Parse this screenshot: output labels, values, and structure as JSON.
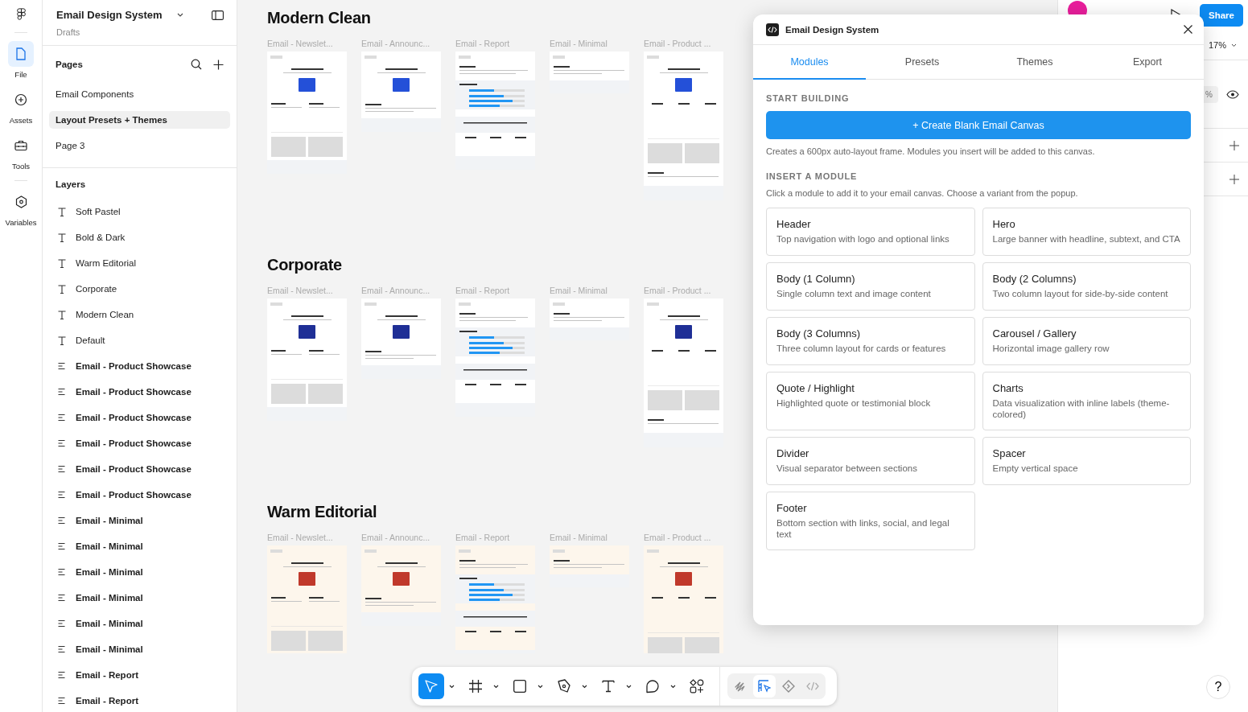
{
  "rail": {
    "items": [
      {
        "kind": "file",
        "label": "File",
        "selected": true
      },
      {
        "kind": "assets",
        "label": "Assets",
        "selected": false
      },
      {
        "kind": "tools",
        "label": "Tools",
        "selected": false
      },
      {
        "kind": "variables",
        "label": "Variables",
        "selected": false
      }
    ]
  },
  "sidebar": {
    "file_name": "Email Design System",
    "location": "Drafts",
    "pages_title": "Pages",
    "pages": [
      {
        "label": "Email Components",
        "selected": false
      },
      {
        "label": "Layout Presets + Themes",
        "selected": true
      },
      {
        "label": "Page 3",
        "selected": false
      }
    ],
    "layers_title": "Layers",
    "layers": [
      {
        "kind": "text",
        "label": "Soft Pastel"
      },
      {
        "kind": "text",
        "label": "Bold & Dark"
      },
      {
        "kind": "text",
        "label": "Warm Editorial"
      },
      {
        "kind": "text",
        "label": "Corporate"
      },
      {
        "kind": "text",
        "label": "Modern Clean"
      },
      {
        "kind": "text",
        "label": "Default"
      },
      {
        "kind": "frame",
        "label": "Email - Product Showcase"
      },
      {
        "kind": "frame",
        "label": "Email - Product Showcase"
      },
      {
        "kind": "frame",
        "label": "Email - Product Showcase"
      },
      {
        "kind": "frame",
        "label": "Email - Product Showcase"
      },
      {
        "kind": "frame",
        "label": "Email - Product Showcase"
      },
      {
        "kind": "frame",
        "label": "Email - Product Showcase"
      },
      {
        "kind": "frame",
        "label": "Email - Minimal"
      },
      {
        "kind": "frame",
        "label": "Email - Minimal"
      },
      {
        "kind": "frame",
        "label": "Email - Minimal"
      },
      {
        "kind": "frame",
        "label": "Email - Minimal"
      },
      {
        "kind": "frame",
        "label": "Email - Minimal"
      },
      {
        "kind": "frame",
        "label": "Email - Minimal"
      },
      {
        "kind": "frame",
        "label": "Email - Report"
      },
      {
        "kind": "frame",
        "label": "Email - Report"
      }
    ]
  },
  "canvas": {
    "sections": [
      {
        "title": "Modern Clean",
        "color": "#2450d8",
        "cream_paper": false,
        "frames": [
          {
            "kind": "newsletter",
            "label": "Email - Newslet..."
          },
          {
            "kind": "announcement",
            "label": "Email - Announc..."
          },
          {
            "kind": "report",
            "label": "Email - Report"
          },
          {
            "kind": "minimal",
            "label": "Email - Minimal"
          },
          {
            "kind": "product",
            "label": "Email - Product ..."
          }
        ]
      },
      {
        "title": "Corporate",
        "color": "#1f2f96",
        "cream_paper": false,
        "frames": [
          {
            "kind": "newsletter",
            "label": "Email - Newslet..."
          },
          {
            "kind": "announcement",
            "label": "Email - Announc..."
          },
          {
            "kind": "report",
            "label": "Email - Report"
          },
          {
            "kind": "minimal",
            "label": "Email - Minimal"
          },
          {
            "kind": "product",
            "label": "Email - Product ..."
          }
        ]
      },
      {
        "title": "Warm Editorial",
        "color": "#c0392b",
        "cream_paper": true,
        "frames": [
          {
            "kind": "newsletter",
            "label": "Email - Newslet..."
          },
          {
            "kind": "announcement",
            "label": "Email - Announc..."
          },
          {
            "kind": "report",
            "label": "Email - Report"
          },
          {
            "kind": "minimal",
            "label": "Email - Minimal"
          },
          {
            "kind": "product",
            "label": "Email - Product ..."
          }
        ]
      }
    ]
  },
  "right_panel": {
    "share": "Share",
    "zoom": "17%",
    "field_suffix": "%"
  },
  "plugin": {
    "title": "Email Design System",
    "tabs": [
      {
        "label": "Modules",
        "selected": true
      },
      {
        "label": "Presets",
        "selected": false
      },
      {
        "label": "Themes",
        "selected": false
      },
      {
        "label": "Export",
        "selected": false
      }
    ],
    "start_heading": "START BUILDING",
    "create_button": "+ Create Blank Email Canvas",
    "create_note": "Creates a 600px auto-layout frame. Modules you insert will be added to this canvas.",
    "insert_heading": "INSERT A MODULE",
    "insert_note": "Click a module to add it to your email canvas. Choose a variant from the popup.",
    "modules": [
      {
        "title": "Header",
        "description": "Top navigation with logo and optional links"
      },
      {
        "title": "Hero",
        "description": "Large banner with headline, subtext, and CTA"
      },
      {
        "title": "Body (1 Column)",
        "description": "Single column text and image content"
      },
      {
        "title": "Body (2 Columns)",
        "description": "Two column layout for side-by-side content"
      },
      {
        "title": "Body (3 Columns)",
        "description": "Three column layout for cards or features"
      },
      {
        "title": "Carousel / Gallery",
        "description": "Horizontal image gallery row"
      },
      {
        "title": "Quote / Highlight",
        "description": "Highlighted quote or testimonial block"
      },
      {
        "title": "Charts",
        "description": "Data visualization with inline labels (theme-colored)"
      },
      {
        "title": "Divider",
        "description": "Visual separator between sections"
      },
      {
        "title": "Spacer",
        "description": "Empty vertical space"
      },
      {
        "title": "Footer",
        "description": "Bottom section with links, social, and legal text"
      }
    ]
  },
  "toolbar": {
    "tools": [
      {
        "kind": "move",
        "selected": true,
        "caret": true
      },
      {
        "kind": "frame",
        "selected": false,
        "caret": true
      },
      {
        "kind": "shape",
        "selected": false,
        "caret": true
      },
      {
        "kind": "pen",
        "selected": false,
        "caret": true
      },
      {
        "kind": "text",
        "selected": false,
        "caret": true
      },
      {
        "kind": "comment",
        "selected": false,
        "caret": true
      },
      {
        "kind": "actions",
        "selected": false,
        "caret": false
      }
    ],
    "modes": [
      {
        "kind": "draw",
        "selected": false
      },
      {
        "kind": "design",
        "selected": true
      },
      {
        "kind": "component",
        "selected": false
      },
      {
        "kind": "code",
        "selected": false
      }
    ]
  },
  "help": "?"
}
